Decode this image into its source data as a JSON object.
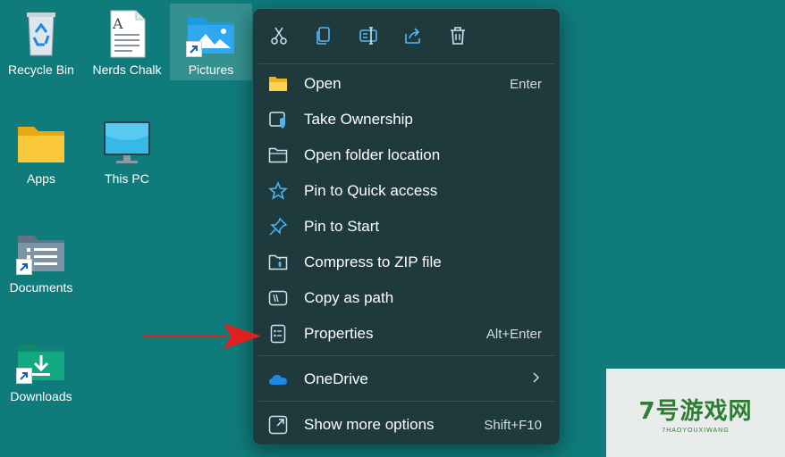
{
  "desktop": {
    "icons": [
      {
        "label": "Recycle Bin",
        "icon": "recycle-bin-icon"
      },
      {
        "label": "Nerds Chalk",
        "icon": "text-document-icon"
      },
      {
        "label": "Pictures",
        "icon": "pictures-folder-icon"
      },
      {
        "label": "Apps",
        "icon": "folder-icon"
      },
      {
        "label": "This PC",
        "icon": "monitor-icon"
      },
      {
        "label": "Documents",
        "icon": "documents-folder-icon"
      },
      {
        "label": "Downloads",
        "icon": "downloads-folder-icon"
      }
    ],
    "background_color": "#0f7b7b"
  },
  "context_menu": {
    "quick_actions": [
      {
        "icon": "cut-icon"
      },
      {
        "icon": "copy-icon"
      },
      {
        "icon": "rename-icon"
      },
      {
        "icon": "share-icon"
      },
      {
        "icon": "delete-icon"
      }
    ],
    "items": [
      {
        "label": "Open",
        "shortcut": "Enter",
        "icon": "folder-open-icon"
      },
      {
        "label": "Take Ownership",
        "shortcut": "",
        "icon": "shield-icon"
      },
      {
        "label": "Open folder location",
        "shortcut": "",
        "icon": "folder-outline-icon"
      },
      {
        "label": "Pin to Quick access",
        "shortcut": "",
        "icon": "star-icon"
      },
      {
        "label": "Pin to Start",
        "shortcut": "",
        "icon": "pin-icon"
      },
      {
        "label": "Compress to ZIP file",
        "shortcut": "",
        "icon": "zip-icon"
      },
      {
        "label": "Copy as path",
        "shortcut": "",
        "icon": "copy-path-icon"
      },
      {
        "label": "Properties",
        "shortcut": "Alt+Enter",
        "icon": "properties-icon"
      },
      {
        "label": "OneDrive",
        "shortcut": "",
        "icon": "onedrive-icon"
      },
      {
        "label": "Show more options",
        "shortcut": "Shift+F10",
        "icon": "show-more-icon"
      }
    ]
  },
  "watermark": {
    "main": "7号游戏网",
    "sub": "7HAOYOUXIWANG"
  },
  "colors": {
    "menu_bg": "#1f3a3d",
    "accent": "#4cc2ff",
    "arrow": "#e02020"
  }
}
